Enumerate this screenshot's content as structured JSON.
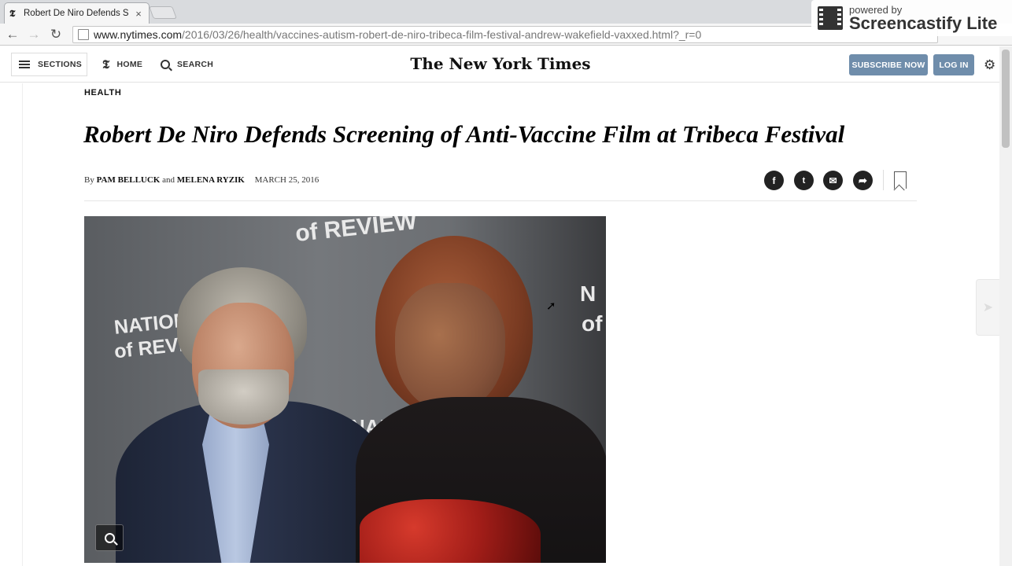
{
  "browser": {
    "tab_favicon": "𝕿",
    "tab_title": "Robert De Niro Defends S",
    "tab_close": "×",
    "back": "←",
    "forward": "→",
    "reload": "↻",
    "url_host": "www.nytimes.com",
    "url_path": "/2016/03/26/health/vaccines-autism-robert-de-niro-tribeca-film-festival-andrew-wakefield-vaxxed.html?_r=0"
  },
  "overlay": {
    "powered_by": "powered by",
    "brand": "Screencastify Lite"
  },
  "header": {
    "sections_label": "SECTIONS",
    "home_glyph": "𝕿",
    "home_label": "HOME",
    "search_label": "SEARCH",
    "masthead": "The New York Times",
    "subscribe_label": "SUBSCRIBE NOW",
    "login_label": "LOG IN",
    "gear_glyph": "⚙"
  },
  "article": {
    "section": "HEALTH",
    "headline": "Robert De Niro Defends Screening of Anti-Vaccine Film at Tribeca Festival",
    "by_prefix": "By",
    "author1": "PAM BELLUCK",
    "and": "and",
    "author2": "MELENA RYZIK",
    "date": "MARCH 25, 2016",
    "share": {
      "facebook": "f",
      "twitter": "t",
      "email": "✉",
      "share": "➦"
    }
  },
  "photo": {
    "wall_text_1": "of REVIEW",
    "wall_text_2": "NATION",
    "wall_text_3": "of REVIE",
    "wall_text_4": "N",
    "wall_text_5": "of",
    "wall_text_6": "NAL",
    "cursor": "➚"
  },
  "right_rail": {
    "next_glyph": "➤"
  },
  "colors": {
    "button_blue": "#6f8dab",
    "tabstrip": "#d9dbde"
  }
}
